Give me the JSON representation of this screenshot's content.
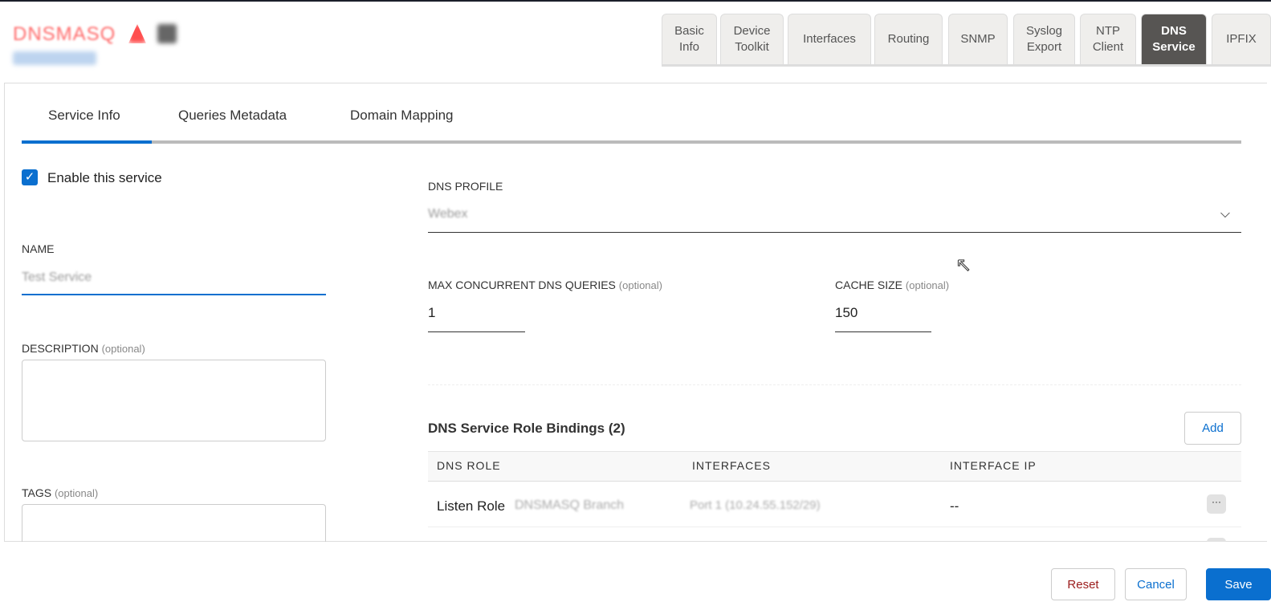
{
  "device": {
    "name": "DNSMASQ",
    "subtitle": "Unbricked"
  },
  "device_tabs": [
    {
      "label": "Basic\nInfo"
    },
    {
      "label": "Device\nToolkit"
    },
    {
      "label": "Interfaces"
    },
    {
      "label": "Routing"
    },
    {
      "label": "SNMP"
    },
    {
      "label": "Syslog\nExport"
    },
    {
      "label": "NTP\nClient"
    },
    {
      "label": "DNS\nService"
    },
    {
      "label": "IPFIX"
    }
  ],
  "sub_tabs": [
    "Service Info",
    "Queries Metadata",
    "Domain Mapping"
  ],
  "form": {
    "enable_label": "Enable this service",
    "name_label": "NAME",
    "name_value": "Test Service",
    "description_label": "DESCRIPTION",
    "optional": "(optional)",
    "tags_label": "TAGS",
    "dns_profile_label": "DNS PROFILE",
    "dns_profile_value": "Webex",
    "max_queries_label": "MAX CONCURRENT DNS QUERIES",
    "max_queries_value": "1",
    "cache_label": "CACHE SIZE",
    "cache_value": "150"
  },
  "bindings": {
    "title": "DNS Service Role Bindings (2)",
    "add_label": "Add",
    "columns": [
      "DNS ROLE",
      "INTERFACES",
      "INTERFACE IP"
    ],
    "rows": [
      {
        "role": "Listen Role",
        "role_blurred": "DNSMASQ Branch",
        "interface": "Port 1 (10.24.55.152/29)",
        "ip": "--"
      }
    ]
  },
  "footer": {
    "reset": "Reset",
    "cancel": "Cancel",
    "save": "Save"
  },
  "colors": {
    "accent": "#0a6fcf",
    "active_tab": "#575553",
    "reset": "#9b1c1c"
  }
}
